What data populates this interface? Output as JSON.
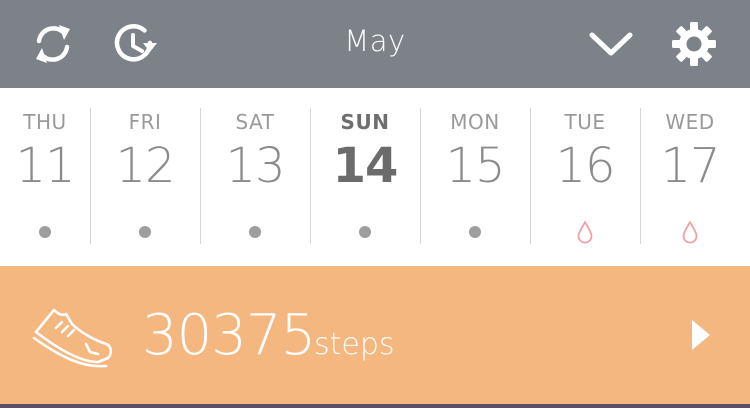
{
  "header": {
    "month": "May",
    "icons": [
      "sync-icon",
      "history-icon",
      "chevron-down-icon",
      "gear-icon"
    ]
  },
  "week": [
    {
      "day": "THU",
      "date": "11",
      "marker": "dot"
    },
    {
      "day": "FRI",
      "date": "12",
      "marker": "dot"
    },
    {
      "day": "SAT",
      "date": "13",
      "marker": "dot"
    },
    {
      "day": "SUN",
      "date": "14",
      "marker": "dot",
      "selected": true
    },
    {
      "day": "MON",
      "date": "15",
      "marker": "dot"
    },
    {
      "day": "TUE",
      "date": "16",
      "marker": "drop"
    },
    {
      "day": "WED",
      "date": "17",
      "marker": "drop"
    }
  ],
  "steps": {
    "value": "30375",
    "unit": "steps",
    "icon": "shoe-icon"
  },
  "colors": {
    "header_bg": "#7d8288",
    "steps_bg": "#f4b780",
    "dot": "#9e9e9e",
    "drop": "#f0a0a8"
  }
}
